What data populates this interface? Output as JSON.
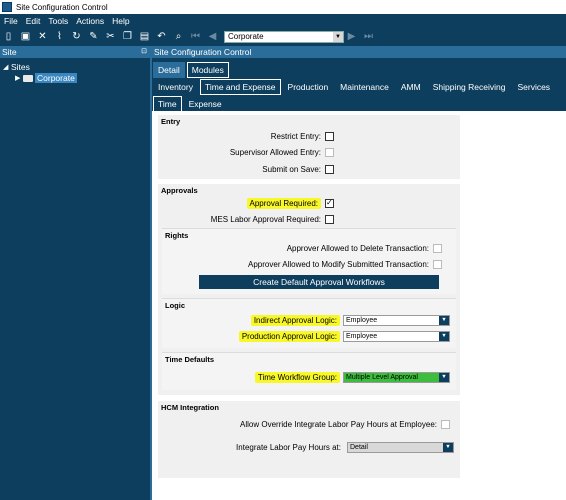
{
  "window": {
    "title": "Site Configuration Control"
  },
  "menu": [
    "File",
    "Edit",
    "Tools",
    "Actions",
    "Help"
  ],
  "toolbar": {
    "company_value": "Corporate"
  },
  "site_panel": {
    "header": "Site",
    "tree": {
      "root": "Sites",
      "child": "Corporate"
    }
  },
  "main": {
    "header": "Site Configuration Control",
    "top_tabs": [
      "Detail",
      "Modules"
    ],
    "module_tabs": [
      "Inventory",
      "Time and Expense",
      "Production",
      "Maintenance",
      "AMM",
      "Shipping Receiving",
      "Services"
    ],
    "sub_tabs": [
      "Time",
      "Expense"
    ]
  },
  "entry": {
    "title": "Entry",
    "restrict_entry": "Restrict Entry:",
    "supervisor_allowed": "Supervisor Allowed Entry:",
    "submit_on_save": "Submit on Save:"
  },
  "approvals": {
    "title": "Approvals",
    "approval_required": "Approval Required:",
    "mes_labor_required": "MES Labor Approval Required:",
    "rights": {
      "title": "Rights",
      "allow_delete": "Approver Allowed to Delete Transaction:",
      "allow_modify": "Approver Allowed to Modify Submitted Transaction:",
      "create_button": "Create Default Approval Workflows"
    },
    "logic": {
      "title": "Logic",
      "indirect_label": "Indirect Approval Logic:",
      "indirect_value": "Employee",
      "production_label": "Production Approval Logic:",
      "production_value": "Employee"
    },
    "time_defaults": {
      "title": "Time Defaults",
      "workflow_label": "Time Workflow Group:",
      "workflow_value": "Multiple Level Approval"
    }
  },
  "hcm": {
    "title": "HCM Integration",
    "allow_override": "Allow Override Integrate Labor Pay Hours at Employee:",
    "integrate_label": "Integrate Labor Pay Hours at:",
    "integrate_value": "Detail"
  },
  "colors": {
    "dark_blue": "#0d3e5e",
    "mid_blue": "#2b6d9a",
    "highlight": "#f7f72a",
    "green": "#3dbd3d"
  }
}
